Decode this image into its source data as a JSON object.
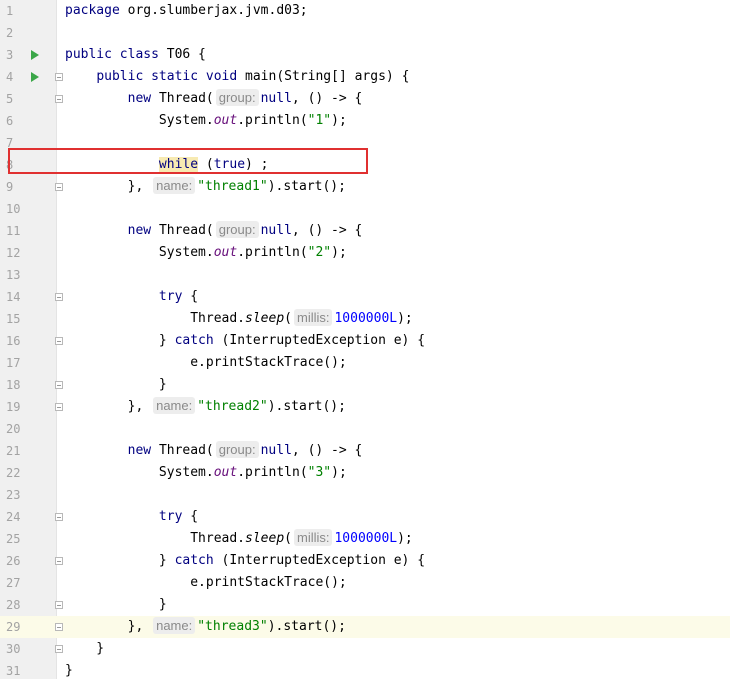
{
  "lines": [
    {
      "n": "1",
      "tokens": [
        {
          "t": "package ",
          "c": "kw"
        },
        {
          "t": "org.slumberjax.jvm.d03;"
        }
      ]
    },
    {
      "n": "2",
      "tokens": []
    },
    {
      "n": "3",
      "tokens": [
        {
          "t": "public class ",
          "c": "kw"
        },
        {
          "t": "T06 {"
        }
      ]
    },
    {
      "n": "4",
      "tokens": [
        {
          "t": "    "
        },
        {
          "t": "public static void ",
          "c": "kw"
        },
        {
          "t": "main(String[] args) {"
        }
      ]
    },
    {
      "n": "5",
      "tokens": [
        {
          "t": "        "
        },
        {
          "t": "new ",
          "c": "kw"
        },
        {
          "t": "Thread("
        },
        {
          "t": "group:",
          "c": "hint"
        },
        {
          "t": "null",
          "c": "kw"
        },
        {
          "t": ", () -> {"
        }
      ]
    },
    {
      "n": "6",
      "tokens": [
        {
          "t": "            System."
        },
        {
          "t": "out",
          "c": "field"
        },
        {
          "t": ".println("
        },
        {
          "t": "\"1\"",
          "c": "str"
        },
        {
          "t": ");"
        }
      ]
    },
    {
      "n": "7",
      "tokens": []
    },
    {
      "n": "8",
      "tokens": [
        {
          "t": "            "
        },
        {
          "t": "while",
          "c": "kw hl-word"
        },
        {
          "t": " ("
        },
        {
          "t": "true",
          "c": "kw"
        },
        {
          "t": ") ;"
        }
      ]
    },
    {
      "n": "9",
      "tokens": [
        {
          "t": "        }, "
        },
        {
          "t": "name:",
          "c": "hint"
        },
        {
          "t": "\"thread1\"",
          "c": "str"
        },
        {
          "t": ").start();"
        }
      ]
    },
    {
      "n": "10",
      "tokens": []
    },
    {
      "n": "11",
      "tokens": [
        {
          "t": "        "
        },
        {
          "t": "new ",
          "c": "kw"
        },
        {
          "t": "Thread("
        },
        {
          "t": "group:",
          "c": "hint"
        },
        {
          "t": "null",
          "c": "kw"
        },
        {
          "t": ", () -> {"
        }
      ]
    },
    {
      "n": "12",
      "tokens": [
        {
          "t": "            System."
        },
        {
          "t": "out",
          "c": "field"
        },
        {
          "t": ".println("
        },
        {
          "t": "\"2\"",
          "c": "str"
        },
        {
          "t": ");"
        }
      ]
    },
    {
      "n": "13",
      "tokens": []
    },
    {
      "n": "14",
      "tokens": [
        {
          "t": "            "
        },
        {
          "t": "try ",
          "c": "kw"
        },
        {
          "t": "{"
        }
      ]
    },
    {
      "n": "15",
      "tokens": [
        {
          "t": "                Thread."
        },
        {
          "t": "sleep",
          "c": "static-m"
        },
        {
          "t": "("
        },
        {
          "t": "millis:",
          "c": "hint"
        },
        {
          "t": "1000000L",
          "c": "num"
        },
        {
          "t": ");"
        }
      ]
    },
    {
      "n": "16",
      "tokens": [
        {
          "t": "            } "
        },
        {
          "t": "catch ",
          "c": "kw"
        },
        {
          "t": "(InterruptedException e) {"
        }
      ]
    },
    {
      "n": "17",
      "tokens": [
        {
          "t": "                e.printStackTrace();"
        }
      ]
    },
    {
      "n": "18",
      "tokens": [
        {
          "t": "            }"
        }
      ]
    },
    {
      "n": "19",
      "tokens": [
        {
          "t": "        }, "
        },
        {
          "t": "name:",
          "c": "hint"
        },
        {
          "t": "\"thread2\"",
          "c": "str"
        },
        {
          "t": ").start();"
        }
      ]
    },
    {
      "n": "20",
      "tokens": []
    },
    {
      "n": "21",
      "tokens": [
        {
          "t": "        "
        },
        {
          "t": "new ",
          "c": "kw"
        },
        {
          "t": "Thread("
        },
        {
          "t": "group:",
          "c": "hint"
        },
        {
          "t": "null",
          "c": "kw"
        },
        {
          "t": ", () -> {"
        }
      ]
    },
    {
      "n": "22",
      "tokens": [
        {
          "t": "            System."
        },
        {
          "t": "out",
          "c": "field"
        },
        {
          "t": ".println("
        },
        {
          "t": "\"3\"",
          "c": "str"
        },
        {
          "t": ");"
        }
      ]
    },
    {
      "n": "23",
      "tokens": []
    },
    {
      "n": "24",
      "tokens": [
        {
          "t": "            "
        },
        {
          "t": "try ",
          "c": "kw"
        },
        {
          "t": "{"
        }
      ]
    },
    {
      "n": "25",
      "tokens": [
        {
          "t": "                Thread."
        },
        {
          "t": "sleep",
          "c": "static-m"
        },
        {
          "t": "("
        },
        {
          "t": "millis:",
          "c": "hint"
        },
        {
          "t": "1000000L",
          "c": "num"
        },
        {
          "t": ");"
        }
      ]
    },
    {
      "n": "26",
      "tokens": [
        {
          "t": "            } "
        },
        {
          "t": "catch ",
          "c": "kw"
        },
        {
          "t": "(InterruptedException e) {"
        }
      ]
    },
    {
      "n": "27",
      "tokens": [
        {
          "t": "                e.printStackTrace();"
        }
      ]
    },
    {
      "n": "28",
      "tokens": [
        {
          "t": "            }"
        }
      ]
    },
    {
      "n": "29",
      "tokens": [
        {
          "t": "        }, "
        },
        {
          "t": "name:",
          "c": "hint"
        },
        {
          "t": "\"thread3\"",
          "c": "str"
        },
        {
          "t": ").start();"
        }
      ]
    },
    {
      "n": "30",
      "tokens": [
        {
          "t": "    }"
        }
      ]
    },
    {
      "n": "31",
      "tokens": [
        {
          "t": "}"
        }
      ]
    }
  ],
  "run_markers": [
    "3",
    "4"
  ],
  "fold_markers": [
    "4",
    "5",
    "9",
    "14",
    "16",
    "18",
    "19",
    "24",
    "26",
    "28",
    "29",
    "30"
  ],
  "current_line": "29",
  "highlight_box_line": "8",
  "colors": {
    "keyword": "#000080",
    "string": "#008000",
    "number": "#0000ff",
    "field": "#660e7a",
    "highlight_box": "#e03030",
    "current_line_bg": "#fcfbe8"
  }
}
